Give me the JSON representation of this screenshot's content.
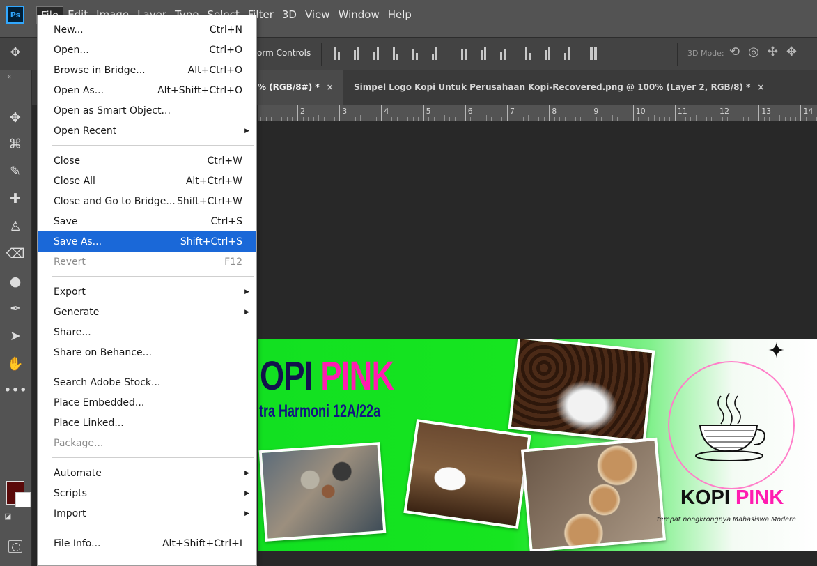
{
  "app": {
    "logo": "Ps"
  },
  "menubar": {
    "items": [
      "File",
      "Edit",
      "Image",
      "Layer",
      "Type",
      "Select",
      "Filter",
      "3D",
      "View",
      "Window",
      "Help"
    ]
  },
  "options_bar": {
    "transform_controls_label": "orm Controls",
    "mode_3d_label": "3D Mode:"
  },
  "tabs": [
    {
      "label": "% (RGB/8#) *",
      "close": "×"
    },
    {
      "label": "Simpel Logo Kopi Untuk Perusahaan Kopi-Recovered.png @ 100% (Layer 2, RGB/8) *",
      "close": "×"
    }
  ],
  "ruler": {
    "ticks": [
      "2",
      "3",
      "4",
      "5",
      "6",
      "7",
      "8",
      "9",
      "10",
      "11",
      "12",
      "13",
      "14"
    ]
  },
  "colors": {
    "foreground": "#5a0a0a",
    "background": "#ffffff",
    "menu_highlight": "#1a68d8"
  },
  "file_menu": {
    "groups": [
      [
        {
          "label": "New...",
          "shortcut": "Ctrl+N"
        },
        {
          "label": "Open...",
          "shortcut": "Ctrl+O"
        },
        {
          "label": "Browse in Bridge...",
          "shortcut": "Alt+Ctrl+O"
        },
        {
          "label": "Open As...",
          "shortcut": "Alt+Shift+Ctrl+O"
        },
        {
          "label": "Open as Smart Object...",
          "shortcut": ""
        },
        {
          "label": "Open Recent",
          "shortcut": "",
          "submenu": true
        }
      ],
      [
        {
          "label": "Close",
          "shortcut": "Ctrl+W"
        },
        {
          "label": "Close All",
          "shortcut": "Alt+Ctrl+W"
        },
        {
          "label": "Close and Go to Bridge...",
          "shortcut": "Shift+Ctrl+W"
        },
        {
          "label": "Save",
          "shortcut": "Ctrl+S"
        },
        {
          "label": "Save As...",
          "shortcut": "Shift+Ctrl+S",
          "highlighted": true
        },
        {
          "label": "Revert",
          "shortcut": "F12",
          "disabled": true
        }
      ],
      [
        {
          "label": "Export",
          "shortcut": "",
          "submenu": true
        },
        {
          "label": "Generate",
          "shortcut": "",
          "submenu": true
        },
        {
          "label": "Share...",
          "shortcut": ""
        },
        {
          "label": "Share on Behance...",
          "shortcut": ""
        }
      ],
      [
        {
          "label": "Search Adobe Stock...",
          "shortcut": ""
        },
        {
          "label": "Place Embedded...",
          "shortcut": ""
        },
        {
          "label": "Place Linked...",
          "shortcut": ""
        },
        {
          "label": "Package...",
          "shortcut": "",
          "disabled": true
        }
      ],
      [
        {
          "label": "Automate",
          "shortcut": "",
          "submenu": true
        },
        {
          "label": "Scripts",
          "shortcut": "",
          "submenu": true
        },
        {
          "label": "Import",
          "shortcut": "",
          "submenu": true
        }
      ],
      [
        {
          "label": "File Info...",
          "shortcut": "Alt+Shift+Ctrl+I"
        }
      ]
    ]
  },
  "artwork": {
    "title_part1": "OPI",
    "title_part2": "PINK",
    "subtitle": "tra Harmoni 12A/22a",
    "logo_name_part1": "KOPI",
    "logo_name_part2": "PINK",
    "logo_tagline": "tempat nongkrongnya Mahasiswa Modern"
  }
}
